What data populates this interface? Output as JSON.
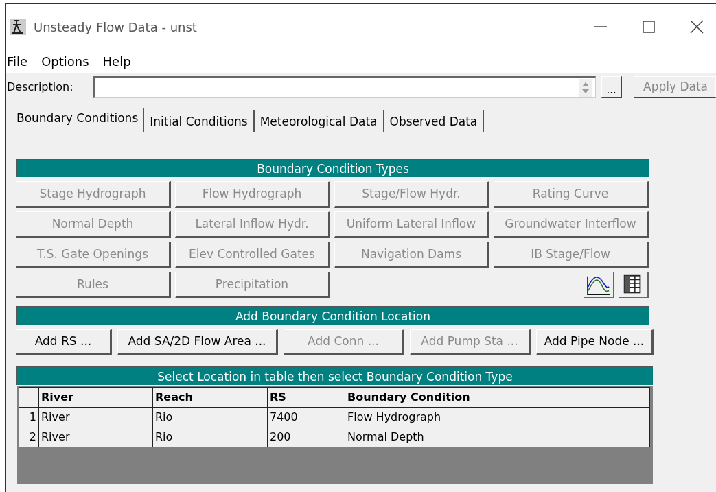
{
  "window": {
    "title": "Unsteady Flow Data - unst"
  },
  "menu": [
    "File",
    "Options",
    "Help"
  ],
  "description": {
    "label": "Description:"
  },
  "ellipsis_button": "...",
  "apply_button": {
    "label": "Apply Data",
    "disabled": true
  },
  "tabs": [
    {
      "label": "Boundary Conditions",
      "selected": true
    },
    {
      "label": "Initial Conditions",
      "selected": false
    },
    {
      "label": "Meteorological Data",
      "selected": false
    },
    {
      "label": "Observed Data",
      "selected": false
    }
  ],
  "boundary_types": {
    "title": "Boundary Condition Types",
    "buttons": [
      {
        "label": "Stage Hydrograph",
        "disabled": true
      },
      {
        "label": "Flow Hydrograph",
        "disabled": true
      },
      {
        "label": "Stage/Flow Hydr.",
        "disabled": true
      },
      {
        "label": "Rating Curve",
        "disabled": true
      },
      {
        "label": "Normal Depth",
        "disabled": true
      },
      {
        "label": "Lateral Inflow Hydr.",
        "disabled": true
      },
      {
        "label": "Uniform Lateral Inflow",
        "disabled": true
      },
      {
        "label": "Groundwater Interflow",
        "disabled": true
      },
      {
        "label": "T.S. Gate Openings",
        "disabled": true
      },
      {
        "label": "Elev Controlled Gates",
        "disabled": true
      },
      {
        "label": "Navigation Dams",
        "disabled": true
      },
      {
        "label": "IB Stage/Flow",
        "disabled": true
      },
      {
        "label": "Rules",
        "disabled": true
      },
      {
        "label": "Precipitation",
        "disabled": true
      }
    ]
  },
  "add_location": {
    "title": "Add Boundary Condition Location",
    "buttons": [
      {
        "label": "Add RS ...",
        "disabled": false
      },
      {
        "label": "Add SA/2D Flow Area ...",
        "disabled": false
      },
      {
        "label": "Add Conn ...",
        "disabled": true
      },
      {
        "label": "Add Pump Sta ...",
        "disabled": true
      },
      {
        "label": "Add Pipe Node ...",
        "disabled": false
      }
    ]
  },
  "table": {
    "title": "Select Location in table then select Boundary Condition Type",
    "columns": [
      "River",
      "Reach",
      "RS",
      "Boundary Condition"
    ],
    "rows": [
      {
        "number": "1",
        "cells": [
          "River",
          "Rio",
          "7400",
          "Flow Hydrograph"
        ]
      },
      {
        "number": "2",
        "cells": [
          "River",
          "Rio",
          "200",
          "Normal Depth"
        ]
      }
    ]
  }
}
